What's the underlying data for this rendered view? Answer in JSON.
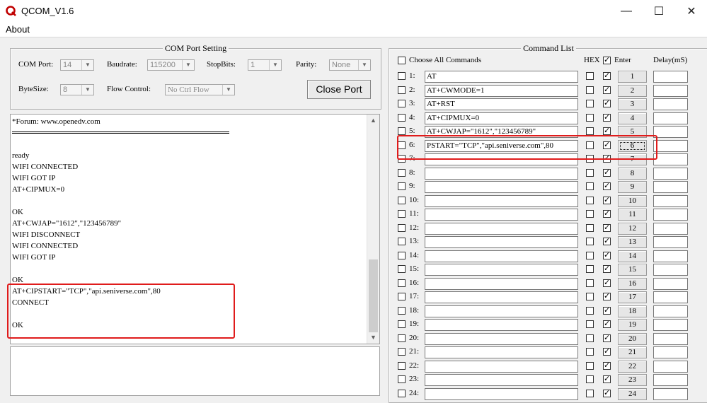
{
  "window": {
    "title": "QCOM_V1.6",
    "minimize_glyph": "—",
    "maximize_glyph": "☐",
    "close_glyph": "✕",
    "icon": "qcom-logo-icon"
  },
  "menu": {
    "about": "About"
  },
  "port_settings": {
    "title": "COM Port Setting",
    "com_port_label": "COM Port:",
    "com_port_value": "14",
    "baudrate_label": "Baudrate:",
    "baudrate_value": "115200",
    "stopbits_label": "StopBits:",
    "stopbits_value": "1",
    "parity_label": "Parity:",
    "parity_value": "None",
    "bytesize_label": "ByteSize:",
    "bytesize_value": "8",
    "flow_control_label": "Flow Control:",
    "flow_control_value": "No Ctrl Flow",
    "close_port_label": "Close Port"
  },
  "receive": {
    "forum_line": "*Forum: www.openedv.com",
    "lines": [
      "ready",
      "WIFI CONNECTED",
      "WIFI GOT IP",
      "AT+CIPMUX=0",
      "",
      "OK",
      "AT+CWJAP=\"1612\",\"123456789\"",
      "WIFI DISCONNECT",
      "WIFI CONNECTED",
      "WIFI GOT IP",
      "",
      "OK",
      "AT+CIPSTART=\"TCP\",\"api.seniverse.com\",80",
      "CONNECT",
      "",
      "OK"
    ]
  },
  "command_list": {
    "title": "Command List",
    "choose_all_label": "Choose All Commands",
    "hex_header": "HEX",
    "enter_header": "Enter",
    "delay_header": "Delay(mS)",
    "rows": [
      {
        "num": "1:",
        "command": "AT",
        "hex": false,
        "enter": true,
        "button": "1"
      },
      {
        "num": "2:",
        "command": "AT+CWMODE=1",
        "hex": false,
        "enter": true,
        "button": "2"
      },
      {
        "num": "3:",
        "command": "AT+RST",
        "hex": false,
        "enter": true,
        "button": "3"
      },
      {
        "num": "4:",
        "command": "AT+CIPMUX=0",
        "hex": false,
        "enter": true,
        "button": "4"
      },
      {
        "num": "5:",
        "command": "AT+CWJAP=\"1612\",\"123456789\"",
        "hex": false,
        "enter": true,
        "button": "5"
      },
      {
        "num": "6:",
        "command": "PSTART=\"TCP\",\"api.seniverse.com\",80",
        "hex": false,
        "enter": true,
        "button": "6"
      },
      {
        "num": "7:",
        "command": "",
        "hex": false,
        "enter": true,
        "button": "7"
      },
      {
        "num": "8:",
        "command": "",
        "hex": false,
        "enter": true,
        "button": "8"
      },
      {
        "num": "9:",
        "command": "",
        "hex": false,
        "enter": true,
        "button": "9"
      },
      {
        "num": "10:",
        "command": "",
        "hex": false,
        "enter": true,
        "button": "10"
      },
      {
        "num": "11:",
        "command": "",
        "hex": false,
        "enter": true,
        "button": "11"
      },
      {
        "num": "12:",
        "command": "",
        "hex": false,
        "enter": true,
        "button": "12"
      },
      {
        "num": "13:",
        "command": "",
        "hex": false,
        "enter": true,
        "button": "13"
      },
      {
        "num": "14:",
        "command": "",
        "hex": false,
        "enter": true,
        "button": "14"
      },
      {
        "num": "15:",
        "command": "",
        "hex": false,
        "enter": true,
        "button": "15"
      },
      {
        "num": "16:",
        "command": "",
        "hex": false,
        "enter": true,
        "button": "16"
      },
      {
        "num": "17:",
        "command": "",
        "hex": false,
        "enter": true,
        "button": "17"
      },
      {
        "num": "18:",
        "command": "",
        "hex": false,
        "enter": true,
        "button": "18"
      },
      {
        "num": "19:",
        "command": "",
        "hex": false,
        "enter": true,
        "button": "19"
      },
      {
        "num": "20:",
        "command": "",
        "hex": false,
        "enter": true,
        "button": "20"
      },
      {
        "num": "21:",
        "command": "",
        "hex": false,
        "enter": true,
        "button": "21"
      },
      {
        "num": "22:",
        "command": "",
        "hex": false,
        "enter": true,
        "button": "22"
      },
      {
        "num": "23:",
        "command": "",
        "hex": false,
        "enter": true,
        "button": "23"
      },
      {
        "num": "24:",
        "command": "",
        "hex": false,
        "enter": true,
        "button": "24"
      }
    ]
  },
  "colors": {
    "highlight": "#e01b1b",
    "window_bg": "#f0f0f0"
  }
}
